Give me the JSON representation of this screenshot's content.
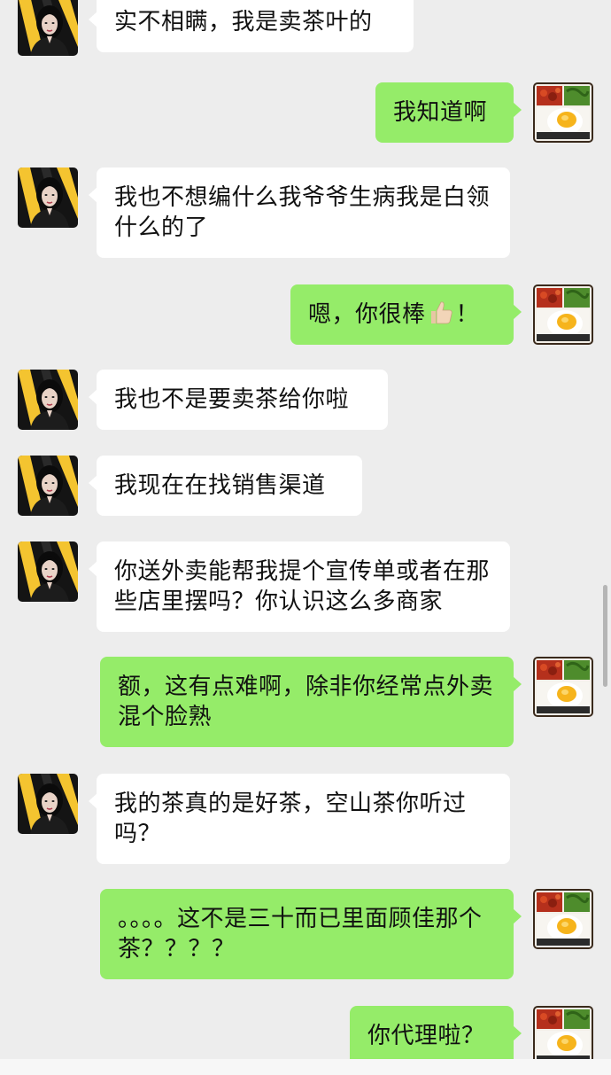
{
  "chat": {
    "messages": [
      {
        "side": "left",
        "text": "实不相瞒，我是卖茶叶的"
      },
      {
        "side": "right",
        "text": "我知道啊"
      },
      {
        "side": "left",
        "text": "我也不想编什么我爷爷生病我是白领什么的了"
      },
      {
        "side": "right",
        "text_before": "嗯，你很棒",
        "emoji": "thumbs-up",
        "text_after": "！"
      },
      {
        "side": "left",
        "text": "我也不是要卖茶给你啦"
      },
      {
        "side": "left",
        "text": "我现在在找销售渠道"
      },
      {
        "side": "left",
        "text": "你送外卖能帮我提个宣传单或者在那些店里摆吗？你认识这么多商家"
      },
      {
        "side": "right",
        "text": "额，这有点难啊，除非你经常点外卖混个脸熟"
      },
      {
        "side": "left",
        "text": "我的茶真的是好茶，空山茶你听过吗？"
      },
      {
        "side": "right",
        "text": "。。。。这不是三十而已里面顾佳那个茶？？？？"
      },
      {
        "side": "right",
        "text": "你代理啦？"
      }
    ]
  },
  "avatars": {
    "left": "woman-portrait-avatar",
    "right": "fried-egg-meal-avatar"
  },
  "colors": {
    "background": "#ededed",
    "sent_bubble": "#95ec69",
    "received_bubble": "#ffffff"
  }
}
